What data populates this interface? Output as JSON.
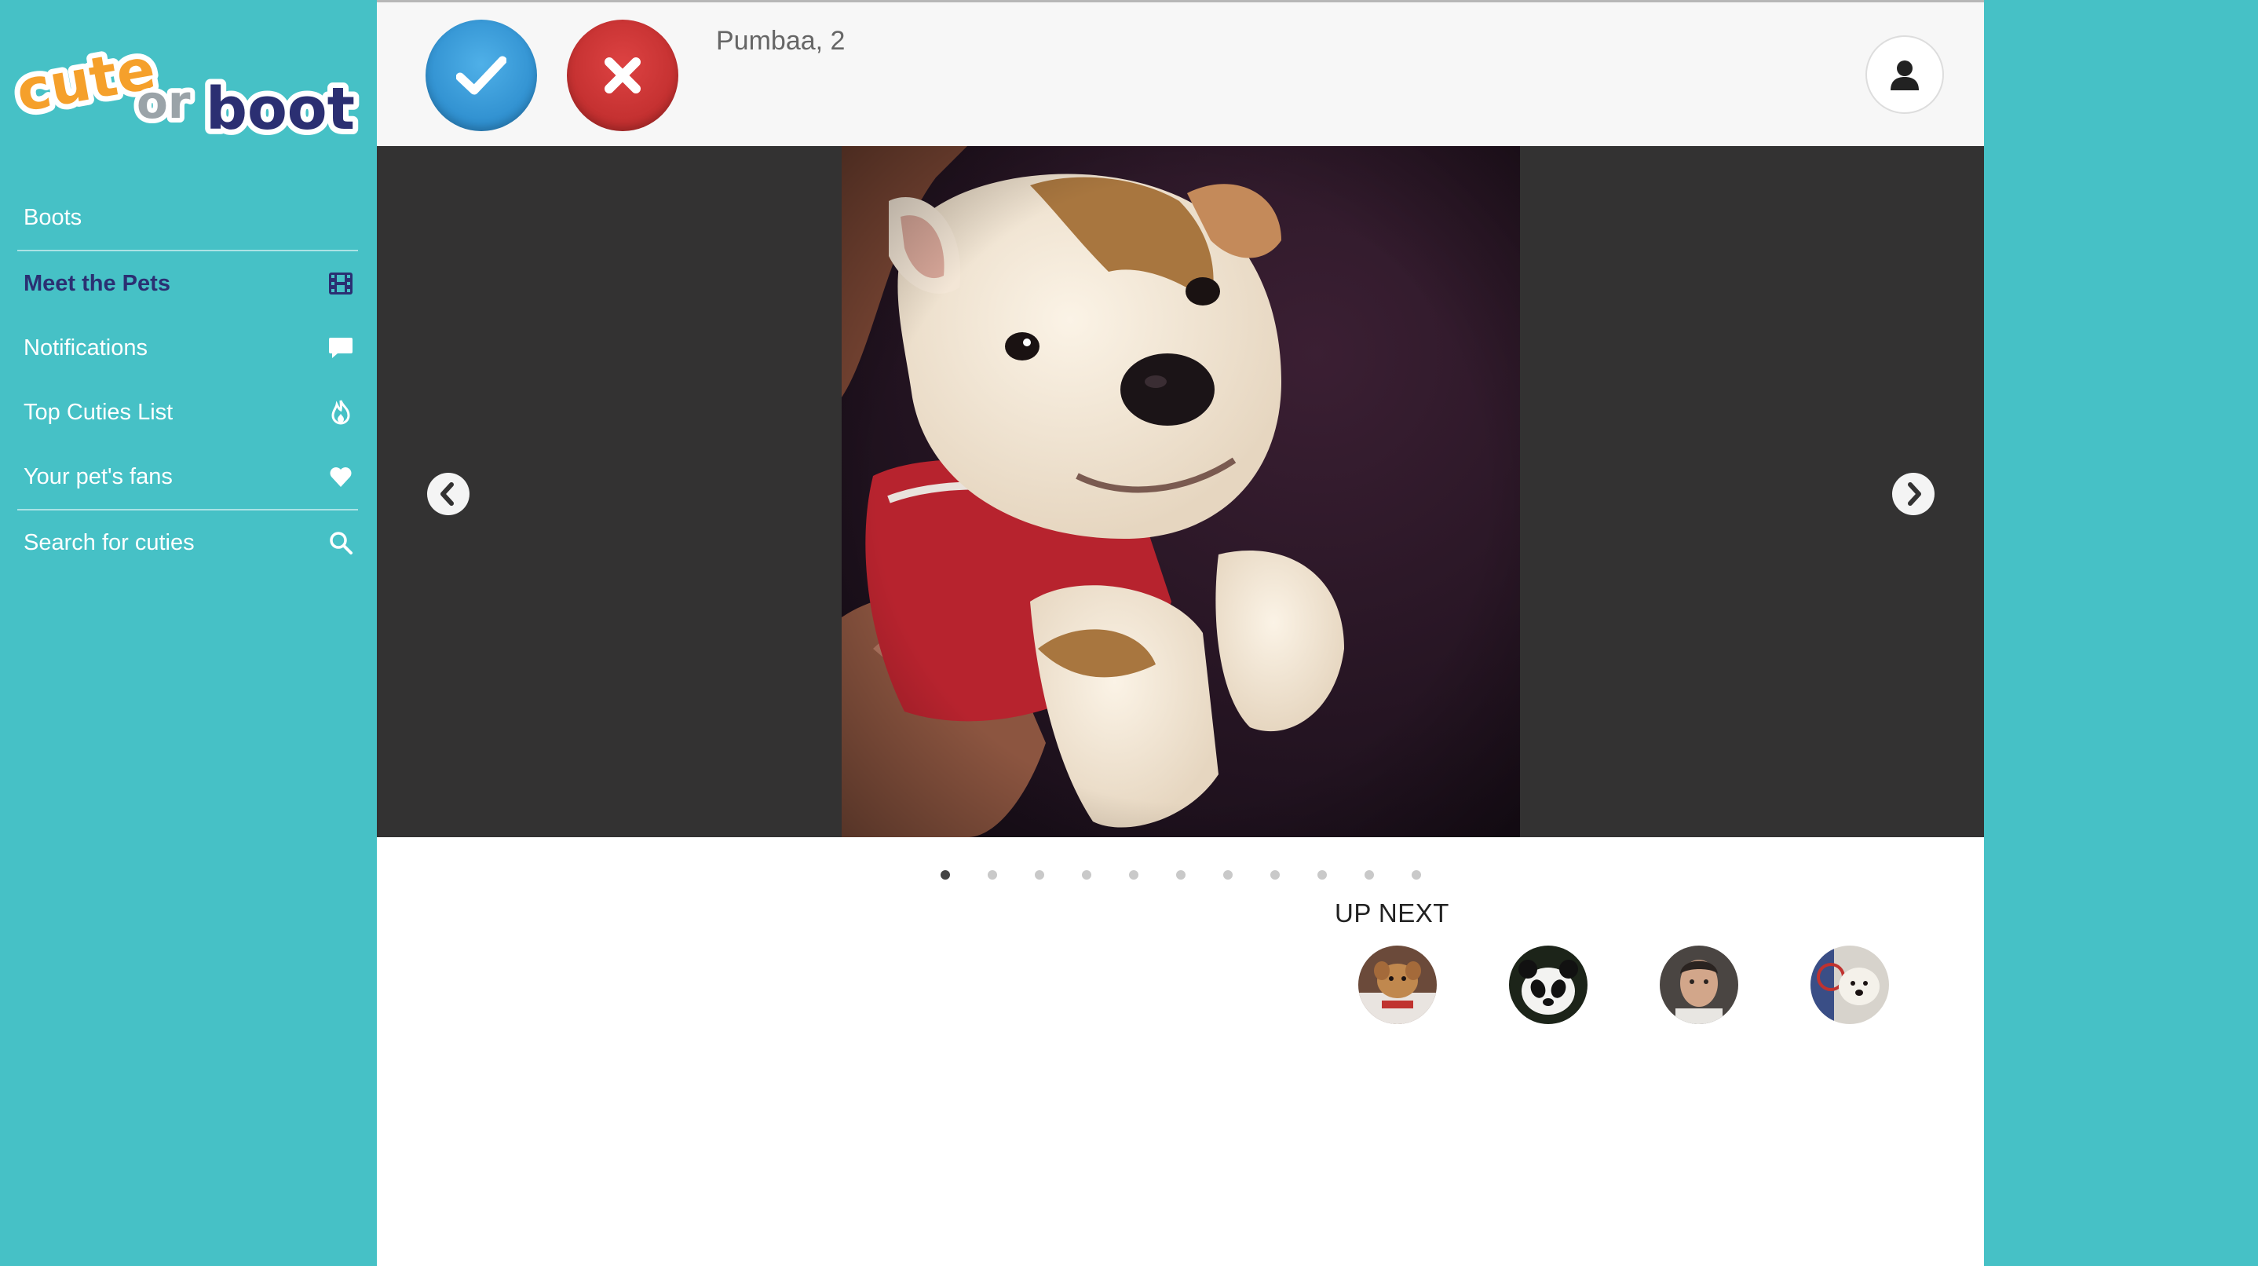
{
  "brand": {
    "logo_word_cute": "cute",
    "logo_word_or": "or",
    "logo_word_boot": "boot",
    "colors": {
      "background": "#46c1c6",
      "cute": "#f5a02b",
      "or": "#9aa3a8",
      "boot": "#2b2f72",
      "active_nav": "#2b2f72"
    }
  },
  "sidebar": {
    "items": [
      {
        "label": "Boots",
        "icon": null,
        "active": false
      },
      {
        "label": "Meet the Pets",
        "icon": "film-icon",
        "active": true
      },
      {
        "label": "Notifications",
        "icon": "chat-bubble-icon",
        "active": false
      },
      {
        "label": "Top Cuties List",
        "icon": "flame-icon",
        "active": false
      },
      {
        "label": "Your pet's fans",
        "icon": "heart-icon",
        "active": false
      },
      {
        "label": "Search for cuties",
        "icon": "search-icon",
        "active": false
      }
    ]
  },
  "header": {
    "pet_name": "Pumbaa, 2",
    "like_icon": "checkmark-icon",
    "boot_icon": "x-icon",
    "profile_icon": "user-icon"
  },
  "carousel": {
    "total_photos": 11,
    "active_index": 0,
    "prev_icon": "chevron-left-icon",
    "next_icon": "chevron-right-icon",
    "photo_subject": "puppy"
  },
  "up_next": {
    "title": "UP NEXT",
    "thumbnails": [
      {
        "subject": "dog"
      },
      {
        "subject": "panda"
      },
      {
        "subject": "man"
      },
      {
        "subject": "dog"
      }
    ]
  }
}
